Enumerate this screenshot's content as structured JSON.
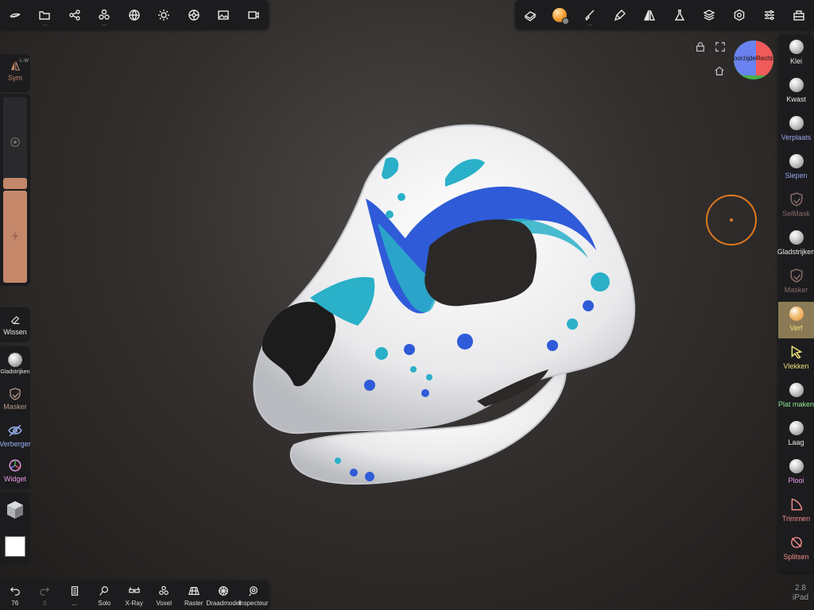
{
  "top_left_tools": [
    {
      "name": "sculpt-icon",
      "dots": ""
    },
    {
      "name": "folder-icon",
      "dots": "..."
    },
    {
      "name": "scene-graph-icon",
      "dots": ""
    },
    {
      "name": "shapes-icon",
      "dots": "..."
    },
    {
      "name": "globe-icon",
      "dots": ""
    },
    {
      "name": "sun-icon",
      "dots": ""
    },
    {
      "name": "material-icon",
      "dots": ""
    },
    {
      "name": "image-icon",
      "dots": ""
    },
    {
      "name": "video-icon",
      "dots": ""
    }
  ],
  "top_right_tools": [
    {
      "name": "eraser-paint-icon"
    },
    {
      "name": "material-ball-icon"
    },
    {
      "name": "brush-icon",
      "dots": "..."
    },
    {
      "name": "paint-tube-icon"
    },
    {
      "name": "symmetry-triangle-icon"
    },
    {
      "name": "flask-icon"
    },
    {
      "name": "layers-icon"
    },
    {
      "name": "settings-icon"
    },
    {
      "name": "sliders-icon"
    },
    {
      "name": "toolbox-icon"
    }
  ],
  "gizmo": {
    "left_label": "Voorzijde",
    "right_label": "Rechts"
  },
  "right_tools": [
    {
      "label": "Klei",
      "color": "#e6e6e6",
      "icon": "sphere"
    },
    {
      "label": "Kwast",
      "color": "#e6e6e6",
      "icon": "sphere"
    },
    {
      "label": "Verplaats",
      "color": "#9aa6f0",
      "icon": "sphere"
    },
    {
      "label": "Slepen",
      "color": "#9aa6f0",
      "icon": "sphere"
    },
    {
      "label": "SelMask",
      "color": "#8a6a6a",
      "icon": "shield"
    },
    {
      "label": "Gladstrijken",
      "color": "#e6e6e6",
      "icon": "sphere"
    },
    {
      "label": "Masker",
      "color": "#8a6a6a",
      "icon": "shield"
    },
    {
      "label": "Verf",
      "color": "#f2e27a",
      "icon": "sphere-orange"
    },
    {
      "label": "Vlekken",
      "color": "#f2e27a",
      "icon": "smudge"
    },
    {
      "label": "Plat maken",
      "color": "#8ee88e",
      "icon": "sphere"
    },
    {
      "label": "Laag",
      "color": "#e6e6e6",
      "icon": "sphere"
    },
    {
      "label": "Plooi",
      "color": "#ee9ae6",
      "icon": "sphere"
    },
    {
      "label": "Trimmen",
      "color": "#f08a8a",
      "icon": "trim"
    },
    {
      "label": "Splitsen",
      "color": "#f08a8a",
      "icon": "split"
    }
  ],
  "sym": {
    "label": "Sym",
    "corner": "L-W"
  },
  "sliders": {
    "radius_level": 0.12,
    "intensity_level": 1.0
  },
  "left_tools": [
    {
      "label": "Wissen",
      "color": "#e6e6e6"
    },
    {
      "label": "Gladstrijken",
      "color": "#e6e6e6"
    },
    {
      "label": "Masker",
      "color": "#b89a8a"
    },
    {
      "label": "Verberger",
      "color": "#9ab0f0"
    },
    {
      "label": "Widget",
      "color": "#ee9ae6"
    }
  ],
  "bottom_tools": [
    {
      "label": "76",
      "name": "undo-button"
    },
    {
      "label": "0",
      "name": "redo-button"
    },
    {
      "label": "...",
      "name": "history-button"
    },
    {
      "label": "Solo",
      "name": "solo-button"
    },
    {
      "label": "X-Ray",
      "name": "xray-button"
    },
    {
      "label": "Voxel",
      "name": "voxel-button"
    },
    {
      "label": "Raster",
      "name": "raster-button"
    },
    {
      "label": "Draadmodel",
      "name": "wireframe-button"
    },
    {
      "label": "Inspecteur",
      "name": "inspector-button"
    }
  ],
  "version": {
    "number": "2.8",
    "device": "iPad"
  },
  "colors": {
    "accent": "#c4876a",
    "brush_ring": "#e07a1f",
    "panel": "#1c1c1e",
    "active_tool": "#8a7a55"
  }
}
